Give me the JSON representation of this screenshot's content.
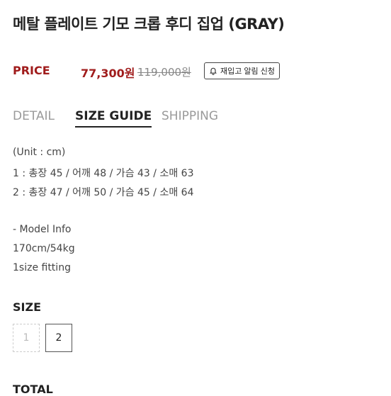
{
  "product": {
    "title": "메탈 플레이트 기모 크롭 후디 집업 (GRAY)"
  },
  "price": {
    "label": "PRICE",
    "sale": "77,300원",
    "original": "119,000원",
    "restock_button": "재입고 알림 신청",
    "restock_icon": "bell-icon"
  },
  "tabs": [
    {
      "label": "DETAIL",
      "active": false
    },
    {
      "label": "SIZE GUIDE",
      "active": true
    },
    {
      "label": "SHIPPING",
      "active": false
    }
  ],
  "size_guide": {
    "unit": "(Unit : cm)",
    "rows": [
      "1 : 총장 45 / 어깨 48 / 가슴 43 / 소매 63",
      "2 : 총장 47 / 어깨 50 / 가슴 45 / 소매 64"
    ]
  },
  "model_info": {
    "heading": "- Model Info",
    "measurements": "170cm/54kg",
    "fitting": "1size fitting"
  },
  "size_selector": {
    "label": "SIZE",
    "options": [
      {
        "label": "1",
        "available": false
      },
      {
        "label": "2",
        "available": true
      }
    ]
  },
  "total": {
    "label": "TOTAL"
  },
  "colors": {
    "accent": "#a01c1c",
    "text": "#333333",
    "muted": "#9a9a9a"
  }
}
